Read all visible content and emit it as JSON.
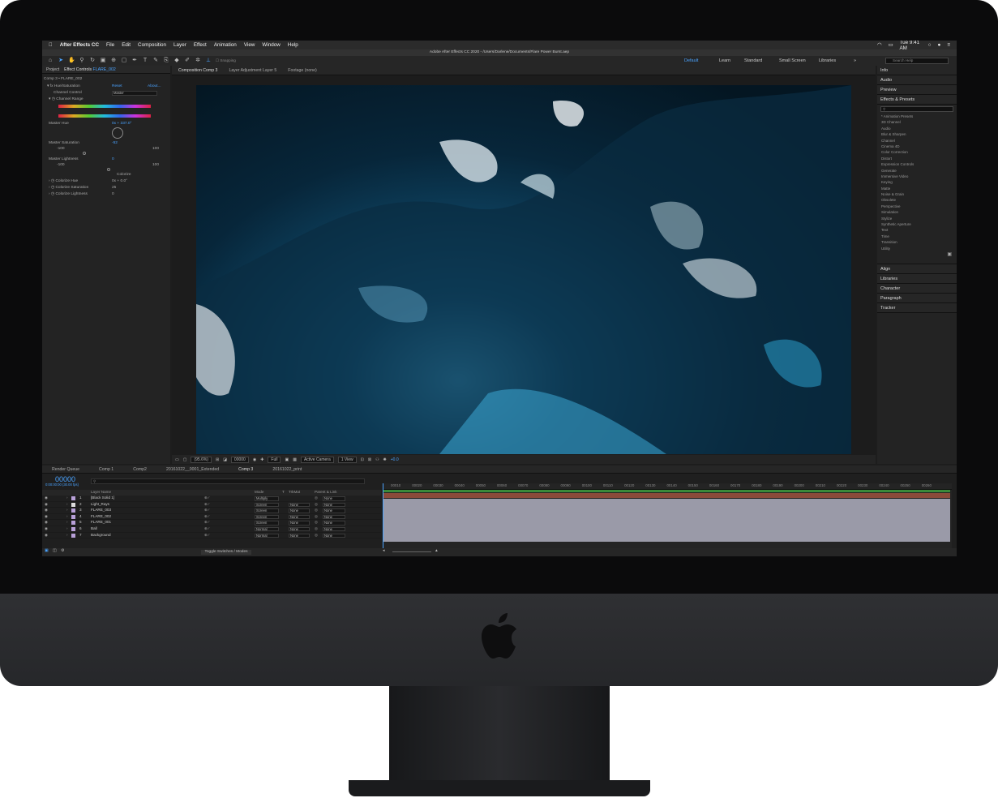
{
  "menubar": {
    "app": "After Effects CC",
    "menus": [
      "File",
      "Edit",
      "Composition",
      "Layer",
      "Effect",
      "Animation",
      "View",
      "Window",
      "Help"
    ],
    "clock": "Tue 9:41 AM"
  },
  "title": "Adobe After Effects CC 2020 - /Users/Darlene/Documents/Flare Power Burst.aep",
  "toolbar": {
    "snapping": "Snapping",
    "workspaces": [
      "Default",
      "Learn",
      "Standard",
      "Small Screen",
      "Libraries"
    ],
    "active_workspace": "Default",
    "search_placeholder": "Search Help"
  },
  "left_panel": {
    "tabs": {
      "project": "Project",
      "effect_controls": "Effect Controls",
      "layer": "FLARE_002"
    },
    "comp_path": "Comp 3 • FLARE_002",
    "effect_name": "Hue/Saturation",
    "reset": "Reset",
    "about": "About...",
    "channel_control_label": "Channel Control",
    "channel_control_value": "Master",
    "channel_range": "Channel Range",
    "master_hue": "Master Hue",
    "master_hue_value": "0x + 337.0°",
    "master_saturation": "Master Saturation",
    "master_saturation_value": "-52",
    "sat_min": "-100",
    "sat_max": "100",
    "master_lightness": "Master Lightness",
    "master_lightness_value": "0",
    "light_min": "-100",
    "light_max": "100",
    "colorize": "Colorize",
    "colorize_hue": "Colorize Hue",
    "colorize_hue_value": "0x + 0.0°",
    "colorize_saturation": "Colorize Saturation",
    "colorize_saturation_value": "25",
    "colorize_lightness": "Colorize Lightness",
    "colorize_lightness_value": "0"
  },
  "viewer": {
    "tabs": [
      "Composition Comp 3",
      "Layer Adjustment Layer 5",
      "Footage (none)"
    ],
    "zoom": "(95.6%)",
    "timecode": "00000",
    "resolution": "Full",
    "camera": "Active Camera",
    "views": "1 View",
    "exposure": "+0.0"
  },
  "right_panel": {
    "info": "Info",
    "audio": "Audio",
    "preview": "Preview",
    "effects_presets": "Effects & Presets",
    "categories": [
      "* Animation Presets",
      "3D Channel",
      "Audio",
      "Blur & Sharpen",
      "Channel",
      "Cinema 4D",
      "Color Correction",
      "Distort",
      "Expression Controls",
      "Generate",
      "Immersive Video",
      "Keying",
      "Matte",
      "Noise & Grain",
      "Obsolete",
      "Perspective",
      "Simulation",
      "Stylize",
      "Synthetic Aperture",
      "Text",
      "Time",
      "Transition",
      "Utility"
    ],
    "bottom": [
      "Align",
      "Libraries",
      "Character",
      "Paragraph",
      "Tracker"
    ]
  },
  "timeline": {
    "tabs": [
      "Render Queue",
      "Comp 1",
      "Comp2",
      "20161022__0001_Extended",
      "Comp 3",
      "20161022_print"
    ],
    "active_tab": "Comp 3",
    "timecode": "00000",
    "timecode_sub": "0:00:00:00 (30.00 fps)",
    "headers": {
      "name": "Layer Name",
      "mode": "Mode",
      "t": "T",
      "trkmat": "TrkMat",
      "parent": "Parent & Link"
    },
    "layers": [
      {
        "num": "1",
        "name": "[Black Solid 1]",
        "mode": "Multiply",
        "trkmat": "",
        "parent": "None",
        "color": "#b8a0d8"
      },
      {
        "num": "2",
        "name": "Light_Rays",
        "mode": "Screen",
        "trkmat": "None",
        "parent": "None",
        "color": "#dddddd"
      },
      {
        "num": "3",
        "name": "FLARE_003",
        "mode": "Screen",
        "trkmat": "None",
        "parent": "None",
        "color": "#b8a0d8"
      },
      {
        "num": "4",
        "name": "FLARE_002",
        "mode": "Screen",
        "trkmat": "None",
        "parent": "None",
        "color": "#b8a0d8"
      },
      {
        "num": "5",
        "name": "FLARE_001",
        "mode": "Screen",
        "trkmat": "None",
        "parent": "None",
        "color": "#b8a0d8"
      },
      {
        "num": "6",
        "name": "Ball",
        "mode": "Normal",
        "trkmat": "None",
        "parent": "None",
        "color": "#b8a0d8"
      },
      {
        "num": "7",
        "name": "Background",
        "mode": "Normal",
        "trkmat": "None",
        "parent": "None",
        "color": "#b8a0d8"
      }
    ],
    "ruler": [
      "00010",
      "00020",
      "00030",
      "00040",
      "00050",
      "00060",
      "00070",
      "00080",
      "00090",
      "00100",
      "00110",
      "00120",
      "00130",
      "00140",
      "00150",
      "00160",
      "00170",
      "00180",
      "00190",
      "00200",
      "00210",
      "00220",
      "00230",
      "00240",
      "00250",
      "00260"
    ],
    "toggle": "Toggle Switches / Modes"
  }
}
